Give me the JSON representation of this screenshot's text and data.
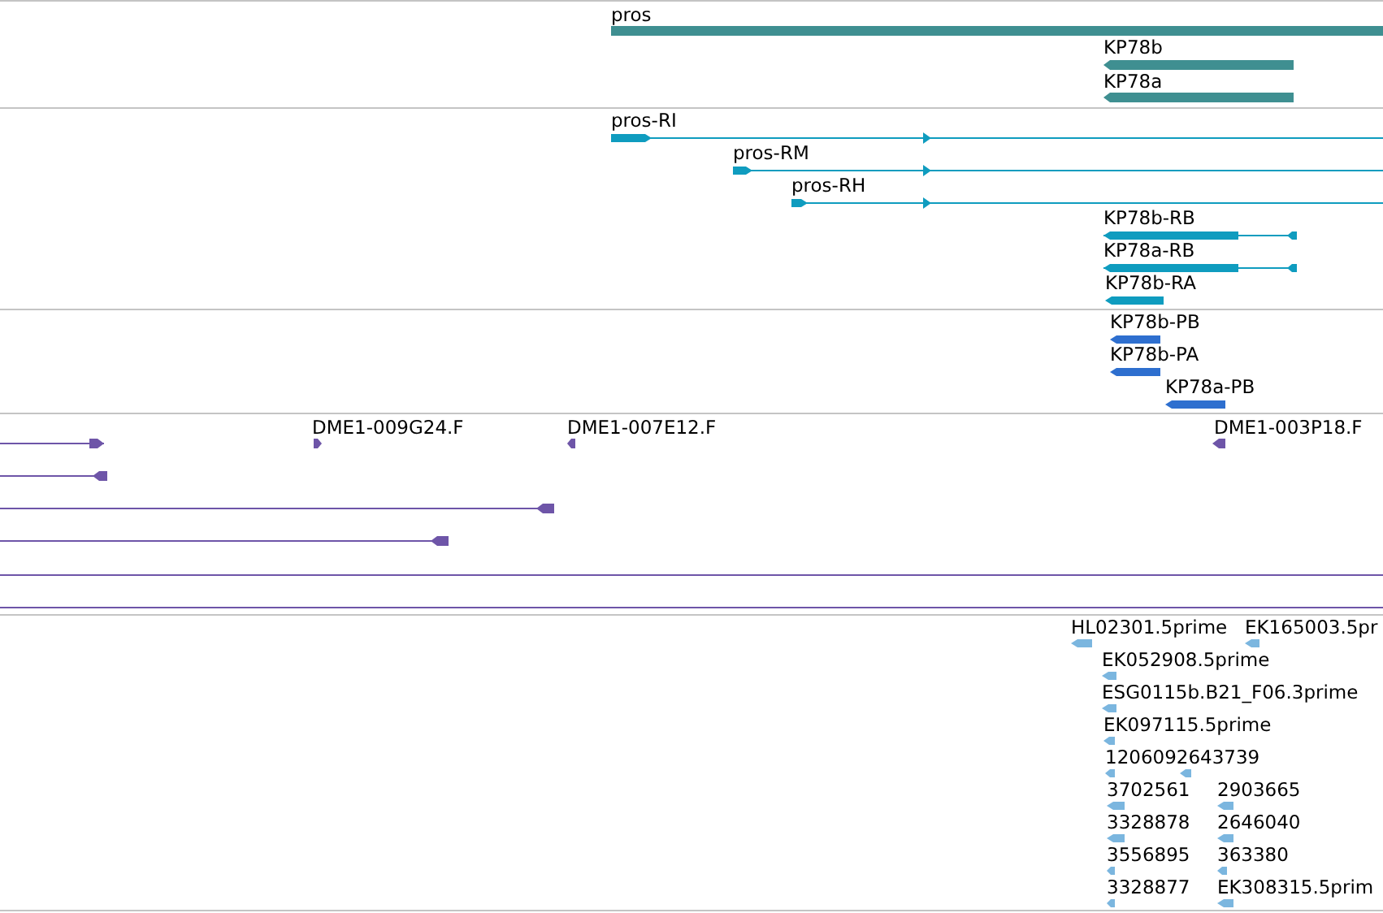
{
  "tracks": [
    {
      "kind": "gene",
      "features": [
        {
          "label": "pros",
          "reverse": false
        },
        {
          "label": "KP78b",
          "reverse": true
        },
        {
          "label": "KP78a",
          "reverse": true
        }
      ]
    },
    {
      "kind": "transcript",
      "features": [
        {
          "label": "pros-RI",
          "reverse": false
        },
        {
          "label": "pros-RM",
          "reverse": false
        },
        {
          "label": "pros-RH",
          "reverse": false
        },
        {
          "label": "KP78b-RB",
          "reverse": true
        },
        {
          "label": "KP78a-RB",
          "reverse": true
        },
        {
          "label": "KP78b-RA",
          "reverse": true
        }
      ]
    },
    {
      "kind": "protein",
      "features": [
        {
          "label": "KP78b-PB",
          "reverse": true
        },
        {
          "label": "KP78b-PA",
          "reverse": true
        },
        {
          "label": "KP78a-PB",
          "reverse": true
        }
      ]
    },
    {
      "kind": "clone",
      "features": [
        {
          "kind": "read",
          "reverse": false
        },
        {
          "kind": "read",
          "label": "DME1-009G24.F",
          "reverse": false
        },
        {
          "kind": "read",
          "label": "DME1-007E12.F",
          "reverse": true
        },
        {
          "kind": "read",
          "label": "DME1-003P18.F",
          "reverse": true
        },
        {
          "kind": "read",
          "reverse": true
        },
        {
          "kind": "read",
          "reverse": true
        },
        {
          "kind": "read",
          "reverse": true
        },
        {
          "kind": "span"
        },
        {
          "kind": "span"
        }
      ]
    },
    {
      "kind": "est",
      "features": [
        {
          "label": "HL02301.5prime",
          "reverse": true
        },
        {
          "label": "EK165003.5pr",
          "reverse": true
        },
        {
          "label": "EK052908.5prime",
          "reverse": true
        },
        {
          "label": "ESG0115b.B21_F06.3prime",
          "reverse": true
        },
        {
          "label": "EK097115.5prime",
          "reverse": true
        },
        {
          "label": "1206092643739",
          "reverse": true
        },
        {
          "reverse": true
        },
        {
          "label": "3702561",
          "reverse": true
        },
        {
          "label": "2903665",
          "reverse": true
        },
        {
          "label": "3328878",
          "reverse": true
        },
        {
          "label": "2646040",
          "reverse": true
        },
        {
          "label": "3556895",
          "reverse": true
        },
        {
          "label": "363380",
          "reverse": true
        },
        {
          "label": "3328877",
          "reverse": true
        },
        {
          "label": "EK308315.5prim",
          "reverse": true
        }
      ]
    }
  ]
}
